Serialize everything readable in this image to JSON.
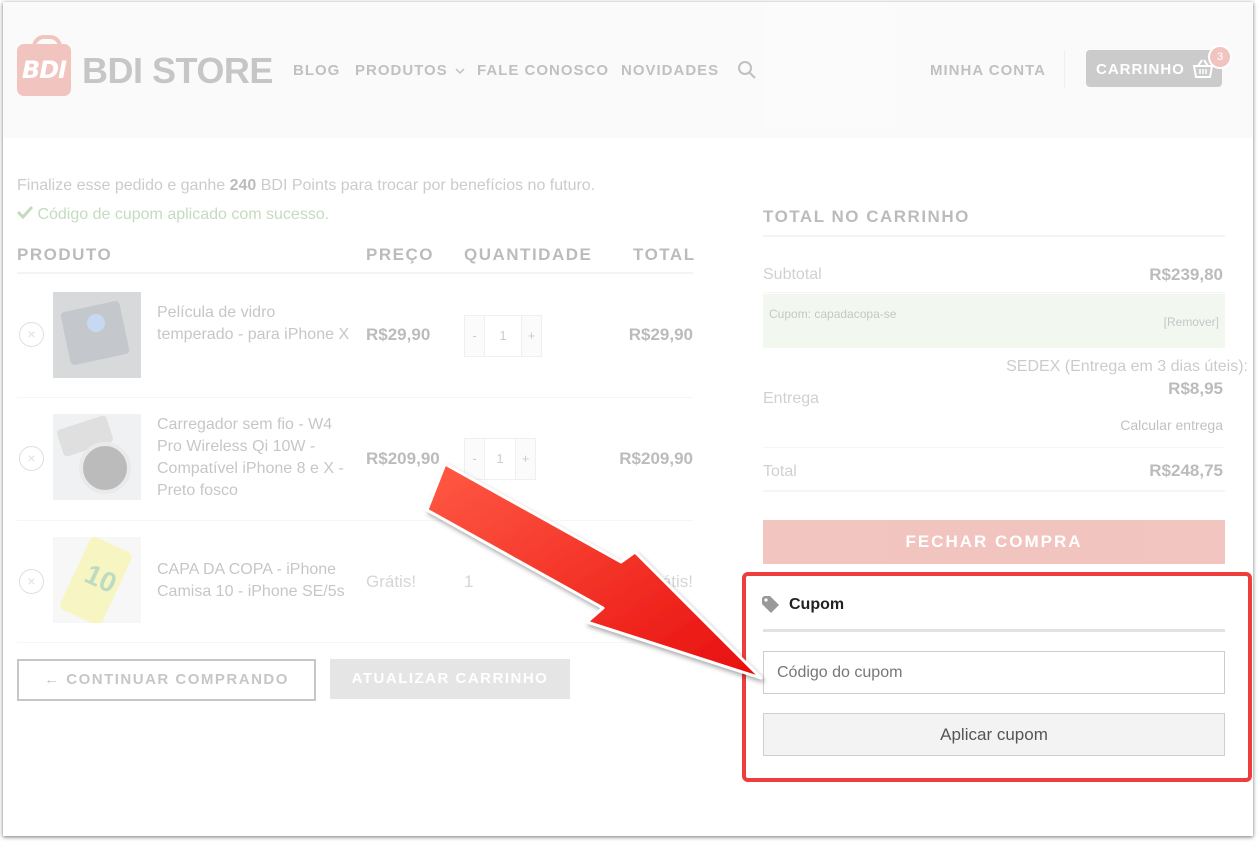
{
  "colors": {
    "brand": "#d6402d",
    "success": "#3d8a2c",
    "highlight": "#ee3d3d",
    "arrow": "#ff2a1f"
  },
  "header": {
    "logo_text": "BDI",
    "brand": "BDI STORE",
    "nav": [
      "BLOG",
      "PRODUTOS",
      "FALE CONOSCO",
      "NOVIDADES"
    ],
    "account": "MINHA CONTA",
    "cart_label": "CARRINHO",
    "cart_count": "3",
    "icons": [
      "search-icon",
      "chevron-down-icon",
      "basket-icon"
    ]
  },
  "cart": {
    "points_prefix": "Finalize esse pedido e ganhe ",
    "points_value": "240",
    "points_suffix": " BDI Points para trocar por benefícios no futuro.",
    "coupon_success": "Código de cupom aplicado com sucesso.",
    "columns": [
      "PRODUTO",
      "PREÇO",
      "QUANTIDADE",
      "TOTAL"
    ],
    "items": [
      {
        "name": "Película de vidro temperado - para iPhone X",
        "price": "R$29,90",
        "qty": "1",
        "total": "R$29,90"
      },
      {
        "name": "Carregador sem fio - W4 Pro Wireless Qi 10W - Compatível iPhone 8 e X - Preto fosco",
        "price": "R$209,90",
        "qty": "1",
        "total": "R$209,90"
      },
      {
        "name": "CAPA DA COPA - iPhone Camisa 10 - iPhone SE/5s",
        "price": "Grátis!",
        "qty": "1",
        "total": "Grátis!"
      }
    ],
    "qty_minus": "-",
    "qty_plus": "+",
    "remove_symbol": "×",
    "continue_button": "← CONTINUAR COMPRANDO",
    "update_button": "ATUALIZAR CARRINHO"
  },
  "totals": {
    "title": "TOTAL NO CARRINHO",
    "subtotal_label": "Subtotal",
    "subtotal_value": "R$239,80",
    "coupon_label": "Cupom: capadacopa-se",
    "coupon_remove": "[Remover]",
    "shipping_label": "Entrega",
    "shipping_method": "SEDEX (Entrega em 3 dias úteis):",
    "shipping_value": "R$8,95",
    "shipping_calc": "Calcular entrega",
    "total_label": "Total",
    "total_value": "R$248,75",
    "checkout_button": "FECHAR COMPRA"
  },
  "coupon_panel": {
    "title": "Cupom",
    "input_placeholder": "Código do cupom",
    "input_value": "",
    "apply_button": "Aplicar cupom"
  }
}
